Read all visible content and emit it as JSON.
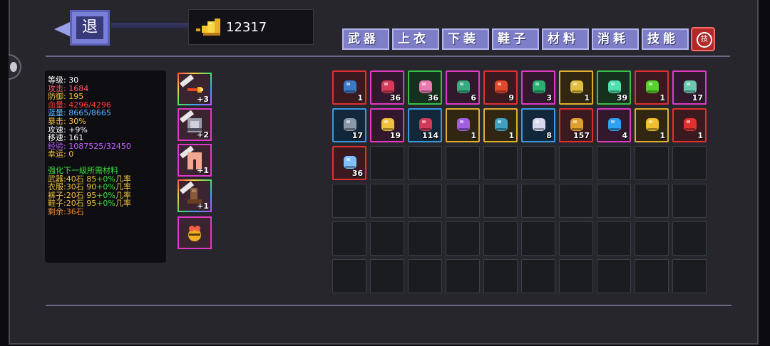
{
  "header": {
    "back_label": "退",
    "gold": "12317"
  },
  "tabs": [
    {
      "label": "武器"
    },
    {
      "label": "上衣"
    },
    {
      "label": "下装"
    },
    {
      "label": "鞋子"
    },
    {
      "label": "材料"
    },
    {
      "label": "消耗"
    },
    {
      "label": "技能"
    }
  ],
  "skill_tab_icon": "技",
  "stats": {
    "level": "等级: 30",
    "attack": "攻击: 1684",
    "defense": "防御: 195",
    "hp": "血量: 4296/4296",
    "mp": "蓝量: 8665/8665",
    "crit": "暴击: 30%",
    "atk_speed": "攻速: +9%",
    "move_speed": "移速: 161",
    "exp": "经验: 1087525/32450",
    "luck": "幸运: 0"
  },
  "upgrade": {
    "title": "强化下一级所需材料",
    "weapon": {
      "name": "武器:40石 85",
      "rate": "+0%",
      "suffix": "几率"
    },
    "clothes": {
      "name": "衣服:30石 90",
      "rate": "+0%",
      "suffix": "几率"
    },
    "pants": {
      "name": "裤子:20石 95",
      "rate": "+0%",
      "suffix": "几率"
    },
    "shoes": {
      "name": "鞋子:20石 95",
      "rate": "+0%",
      "suffix": "几率"
    },
    "remaining": "剩余:36石"
  },
  "equipment": [
    {
      "name": "weapon-slot",
      "count": "+3",
      "icon": "fire-staff-icon",
      "used": true
    },
    {
      "name": "armor-slot",
      "count": "+2",
      "icon": "chest-armor-icon",
      "used": true
    },
    {
      "name": "pants-slot",
      "count": "+1",
      "icon": "pants-icon",
      "used": true
    },
    {
      "name": "shoes-slot",
      "count": "+1",
      "icon": "boots-icon",
      "used": true
    },
    {
      "name": "pet-slot",
      "count": "",
      "icon": "bee-pet-icon",
      "used": false
    }
  ],
  "inventory": [
    {
      "icon": "blue-book-icon",
      "count": "1",
      "rarity": "red",
      "color": "#3a7ac8"
    },
    {
      "icon": "red-crystal-icon",
      "count": "36",
      "rarity": "pink",
      "color": "#d83a5a"
    },
    {
      "icon": "pink-key-icon",
      "count": "36",
      "rarity": "green",
      "color": "#e87ab0"
    },
    {
      "icon": "green-potion-icon",
      "count": "6",
      "rarity": "pink",
      "color": "#3aa880"
    },
    {
      "icon": "fire-demon-icon",
      "count": "9",
      "rarity": "red",
      "color": "#e04a2a"
    },
    {
      "icon": "green-fish-icon",
      "count": "3",
      "rarity": "pink",
      "color": "#2ab070"
    },
    {
      "icon": "compass-icon",
      "count": "1",
      "rarity": "gold",
      "color": "#e0c040"
    },
    {
      "icon": "green-spark-icon",
      "count": "39",
      "rarity": "green",
      "color": "#50e0b0"
    },
    {
      "icon": "green-orb-icon",
      "count": "1",
      "rarity": "red",
      "color": "#58d030"
    },
    {
      "icon": "bottle-icon",
      "count": "17",
      "rarity": "pink",
      "color": "#6ac8b0"
    },
    {
      "icon": "empty-bottle-icon",
      "count": "17",
      "rarity": "blue",
      "color": "#8a98a8"
    },
    {
      "icon": "rainbow-gem-icon",
      "count": "19",
      "rarity": "pink",
      "color": "#f0c040"
    },
    {
      "icon": "anatomical-heart-icon",
      "count": "114",
      "rarity": "blue",
      "color": "#d03a5a"
    },
    {
      "icon": "crystal-cluster-icon",
      "count": "1",
      "rarity": "gold",
      "color": "#a060e0"
    },
    {
      "icon": "rune-tablet-icon",
      "count": "1",
      "rarity": "gold",
      "color": "#40a0c0"
    },
    {
      "icon": "egg-icon",
      "count": "8",
      "rarity": "blue",
      "color": "#d8d8f0"
    },
    {
      "icon": "gold-block-icon",
      "count": "157",
      "rarity": "red",
      "color": "#e0a030"
    },
    {
      "icon": "blue-orb-icon",
      "count": "4",
      "rarity": "pink",
      "color": "#30a0f0"
    },
    {
      "icon": "gold-medal-icon",
      "count": "1",
      "rarity": "gold",
      "color": "#f0c030"
    },
    {
      "icon": "red-beetle-icon",
      "count": "1",
      "rarity": "red",
      "color": "#e03030"
    },
    {
      "icon": "blue-sparkles-icon",
      "count": "36",
      "rarity": "red",
      "color": "#80c0ff"
    }
  ],
  "total_slots": 60
}
